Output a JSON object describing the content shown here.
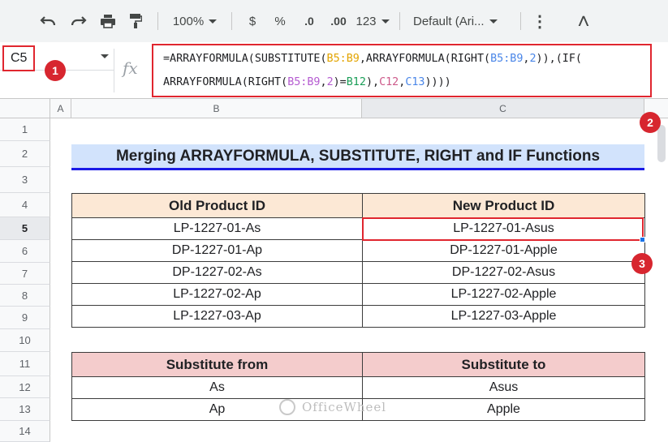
{
  "toolbar": {
    "zoom": "100%",
    "currency": "$",
    "percent": "%",
    "decrease_decimal": ".0",
    "increase_decimal": ".00",
    "number_format": "123",
    "font": "Default (Ari...",
    "more": "⋮",
    "collapse": "˄"
  },
  "name_box": {
    "value": "C5"
  },
  "formula_bar": {
    "fx_label": "fx",
    "line1": [
      {
        "t": "=ARRAYFORMULA(SUBSTITUTE(",
        "c": ""
      },
      {
        "t": "B5:B9",
        "c": "a"
      },
      {
        "t": ",ARRAYFORMULA(RIGHT(",
        "c": ""
      },
      {
        "t": "B5:B9",
        "c": "b"
      },
      {
        "t": ",",
        "c": ""
      },
      {
        "t": "2",
        "c": "b"
      },
      {
        "t": ")),(IF(",
        "c": ""
      }
    ],
    "line2": [
      {
        "t": "ARRAYFORMULA(RIGHT(",
        "c": ""
      },
      {
        "t": "B5:B9",
        "c": "c"
      },
      {
        "t": ",",
        "c": ""
      },
      {
        "t": "2",
        "c": "c"
      },
      {
        "t": ")=",
        "c": ""
      },
      {
        "t": "B12",
        "c": "d"
      },
      {
        "t": "),",
        "c": ""
      },
      {
        "t": "C12",
        "c": "e"
      },
      {
        "t": ",",
        "c": ""
      },
      {
        "t": "C13",
        "c": "b"
      },
      {
        "t": "))))",
        "c": ""
      }
    ]
  },
  "columns": [
    "A",
    "B",
    "C"
  ],
  "rows": [
    "1",
    "2",
    "3",
    "4",
    "5",
    "6",
    "7",
    "8",
    "9",
    "10",
    "11",
    "12",
    "13",
    "14"
  ],
  "sheet_title": "Merging ARRAYFORMULA, SUBSTITUTE, RIGHT and IF Functions",
  "product_table": {
    "headers": [
      "Old Product ID",
      "New Product ID"
    ],
    "rows": [
      [
        "LP-1227-01-As",
        "LP-1227-01-Asus"
      ],
      [
        "DP-1227-01-Ap",
        "DP-1227-01-Apple"
      ],
      [
        "DP-1227-02-As",
        "DP-1227-02-Asus"
      ],
      [
        "LP-1227-02-Ap",
        "LP-1227-02-Apple"
      ],
      [
        "LP-1227-03-Ap",
        "LP-1227-03-Apple"
      ]
    ]
  },
  "substitute_table": {
    "headers": [
      "Substitute from",
      "Substitute to"
    ],
    "rows": [
      [
        "As",
        "Asus"
      ],
      [
        "Ap",
        "Apple"
      ]
    ]
  },
  "badges": [
    "1",
    "2",
    "3"
  ],
  "watermark": "OfficeWheel"
}
